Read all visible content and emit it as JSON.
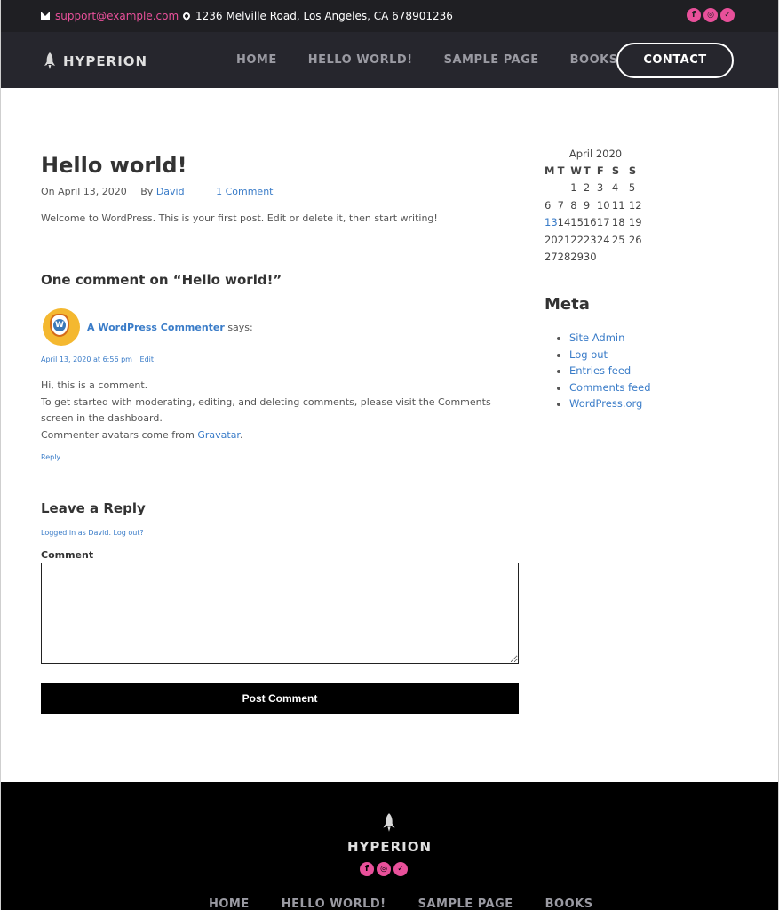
{
  "topbar": {
    "email": "support@example.com",
    "address": "1236 Melville Road, Los Angeles, CA 678901236",
    "socials": [
      "facebook-icon",
      "instagram-icon",
      "twitter-icon"
    ]
  },
  "header": {
    "logo": "HYPERION",
    "nav": [
      "HOME",
      "HELLO WORLD!",
      "SAMPLE PAGE",
      "BOOKS"
    ],
    "contact": "CONTACT"
  },
  "post": {
    "title": "Hello world!",
    "date_prefix": "On",
    "date": "April 13, 2020",
    "by_prefix": "By",
    "author": "David",
    "comments_link": "1 Comment",
    "body": "Welcome to WordPress. This is your first post. Edit or delete it, then start writing!"
  },
  "comments": {
    "title": "One comment on “Hello world!”",
    "author": "A WordPress Commenter",
    "says": "says:",
    "date": "April 13, 2020 at 6:56 pm",
    "edit": "Edit",
    "line1": "Hi, this is a comment.",
    "line2": "To get started with moderating, editing, and deleting comments, please visit the Comments screen in the dashboard.",
    "line3_prefix": "Commenter avatars come from",
    "line3_link": "Gravatar",
    "line3_suffix": ".",
    "reply": "Reply"
  },
  "reply_form": {
    "title": "Leave a Reply",
    "logged": "Logged in as David. Log out?",
    "label": "Comment",
    "button": "Post Comment"
  },
  "calendar": {
    "caption": "April 2020",
    "headers": [
      "M",
      "T",
      "W",
      "T",
      "F",
      "S",
      "S"
    ],
    "rows": [
      [
        "",
        "",
        "1",
        "2",
        "3",
        "4",
        "5"
      ],
      [
        "6",
        "7",
        "8",
        "9",
        "10",
        "11",
        "12"
      ],
      [
        "13",
        "14",
        "15",
        "16",
        "17",
        "18",
        "19"
      ],
      [
        "20",
        "21",
        "22",
        "23",
        "24",
        "25",
        "26"
      ],
      [
        "27",
        "28",
        "29",
        "30",
        "",
        "",
        ""
      ]
    ],
    "linked_day": "13"
  },
  "meta": {
    "title": "Meta",
    "items": [
      "Site Admin",
      "Log out",
      "Entries feed",
      "Comments feed",
      "WordPress.org"
    ]
  },
  "footer": {
    "logo": "HYPERION",
    "nav": [
      "HOME",
      "HELLO WORLD!",
      "SAMPLE PAGE",
      "BOOKS"
    ]
  },
  "colors": {
    "accent": "#e8509a",
    "link": "#3a7cc8",
    "header_bg": "#26262d",
    "topbar_bg": "#1f1f23"
  }
}
